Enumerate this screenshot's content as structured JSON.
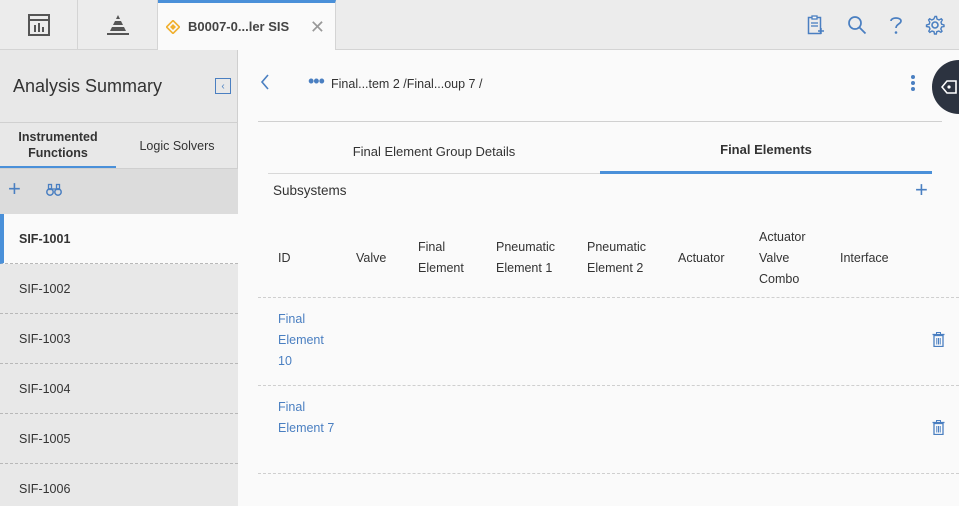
{
  "topbar": {
    "active_tab_label": "B0007-0...ler SIS",
    "colors": {
      "accent": "#4a90d9",
      "tab_icon": "#f0b030",
      "icon": "#4a7fc1"
    }
  },
  "left_panel": {
    "title": "Analysis Summary",
    "tabs": [
      {
        "label": "Instrumented Functions",
        "active": true
      },
      {
        "label": "Logic Solvers",
        "active": false
      }
    ],
    "items": [
      {
        "label": "SIF-1001",
        "active": true
      },
      {
        "label": "SIF-1002"
      },
      {
        "label": "SIF-1003"
      },
      {
        "label": "SIF-1004"
      },
      {
        "label": "SIF-1005"
      },
      {
        "label": "SIF-1006"
      }
    ]
  },
  "main": {
    "breadcrumb": "Final...tem 2 /Final...oup 7 /",
    "tabs": [
      {
        "label": "Final Element Group Details",
        "active": false
      },
      {
        "label": "Final Elements",
        "active": true
      }
    ],
    "section_title": "Subsystems",
    "table": {
      "columns": [
        "ID",
        "Valve",
        "Final Element",
        "Pneumatic Element 1",
        "Pneumatic Element 2",
        "Actuator",
        "Actuator Valve Combo",
        "Interface"
      ],
      "rows": [
        {
          "id": "Final Element 10"
        },
        {
          "id": "Final Element 7"
        }
      ]
    }
  }
}
